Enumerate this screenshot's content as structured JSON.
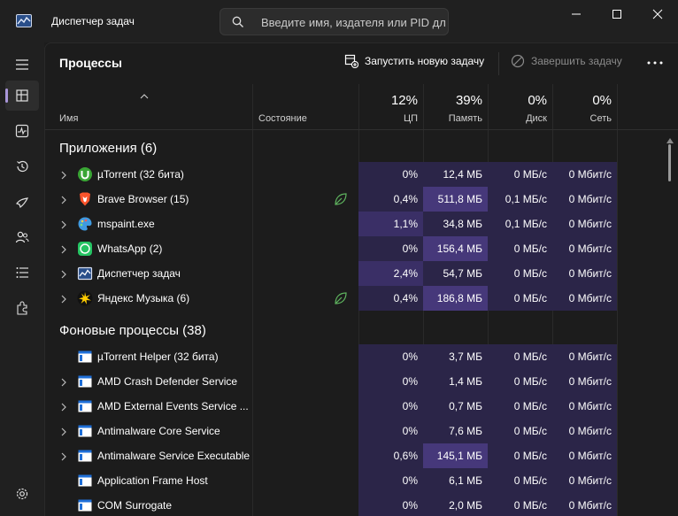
{
  "window": {
    "title": "Диспетчер задач",
    "search_placeholder": "Введите имя, издателя или PID для поиска"
  },
  "nav": {
    "items": [
      {
        "name": "processes",
        "icon": "processes-icon",
        "active": true
      },
      {
        "name": "performance",
        "icon": "performance-icon"
      },
      {
        "name": "app-history",
        "icon": "history-icon"
      },
      {
        "name": "startup",
        "icon": "startup-icon"
      },
      {
        "name": "users",
        "icon": "users-icon"
      },
      {
        "name": "details",
        "icon": "details-icon"
      },
      {
        "name": "services",
        "icon": "services-icon"
      }
    ],
    "settings_icon": "gear-icon"
  },
  "toolbar": {
    "page_title": "Процессы",
    "run_task": "Запустить новую задачу",
    "end_task": "Завершить задачу"
  },
  "table": {
    "headers": {
      "name": "Имя",
      "status": "Состояние",
      "cpu_pct": "12%",
      "cpu": "ЦП",
      "mem_pct": "39%",
      "mem": "Память",
      "disk_pct": "0%",
      "disk": "Диск",
      "net_pct": "0%",
      "net": "Сеть"
    },
    "apps_title": "Приложения (6)",
    "apps": [
      {
        "name": "µTorrent (32 бита)",
        "icon": "utorrent-icon",
        "cpu": "0%",
        "mem": "12,4 МБ",
        "disk": "0 МБ/с",
        "net": "0 Мбит/с",
        "expandable": true,
        "eco": false
      },
      {
        "name": "Brave Browser (15)",
        "icon": "brave-icon",
        "cpu": "0,4%",
        "mem": "511,8 МБ",
        "disk": "0,1 МБ/с",
        "net": "0 Мбит/с",
        "expandable": true,
        "eco": true
      },
      {
        "name": "mspaint.exe",
        "icon": "paint-icon",
        "cpu": "1,1%",
        "mem": "34,8 МБ",
        "disk": "0,1 МБ/с",
        "net": "0 Мбит/с",
        "expandable": true,
        "eco": false
      },
      {
        "name": "WhatsApp (2)",
        "icon": "whatsapp-icon",
        "cpu": "0%",
        "mem": "156,4 МБ",
        "disk": "0 МБ/с",
        "net": "0 Мбит/с",
        "expandable": true,
        "eco": false
      },
      {
        "name": "Диспетчер задач",
        "icon": "task-manager-icon",
        "cpu": "2,4%",
        "mem": "54,7 МБ",
        "disk": "0 МБ/с",
        "net": "0 Мбит/с",
        "expandable": true,
        "eco": false
      },
      {
        "name": "Яндекс Музыка (6)",
        "icon": "yandex-music-icon",
        "cpu": "0,4%",
        "mem": "186,8 МБ",
        "disk": "0 МБ/с",
        "net": "0 Мбит/с",
        "expandable": true,
        "eco": true
      }
    ],
    "bg_title": "Фоновые процессы (38)",
    "background": [
      {
        "name": "µTorrent Helper (32 бита)",
        "icon": "service-window-icon",
        "cpu": "0%",
        "mem": "3,7 МБ",
        "disk": "0 МБ/с",
        "net": "0 Мбит/с",
        "expandable": false
      },
      {
        "name": "AMD Crash Defender Service",
        "icon": "service-window-icon",
        "cpu": "0%",
        "mem": "1,4 МБ",
        "disk": "0 МБ/с",
        "net": "0 Мбит/с",
        "expandable": true
      },
      {
        "name": "AMD External Events Service ...",
        "icon": "service-window-icon",
        "cpu": "0%",
        "mem": "0,7 МБ",
        "disk": "0 МБ/с",
        "net": "0 Мбит/с",
        "expandable": true
      },
      {
        "name": "Antimalware Core Service",
        "icon": "service-window-icon",
        "cpu": "0%",
        "mem": "7,6 МБ",
        "disk": "0 МБ/с",
        "net": "0 Мбит/с",
        "expandable": true
      },
      {
        "name": "Antimalware Service Executable",
        "icon": "service-window-icon",
        "cpu": "0,6%",
        "mem": "145,1 МБ",
        "disk": "0 МБ/с",
        "net": "0 Мбит/с",
        "expandable": true
      },
      {
        "name": "Application Frame Host",
        "icon": "service-window-icon",
        "cpu": "0%",
        "mem": "6,1 МБ",
        "disk": "0 МБ/с",
        "net": "0 Мбит/с",
        "expandable": false
      },
      {
        "name": "COM Surrogate",
        "icon": "service-window-icon",
        "cpu": "0%",
        "mem": "2,0 МБ",
        "disk": "0 МБ/с",
        "net": "0 Мбит/с",
        "expandable": false
      }
    ]
  },
  "colors": {
    "heat_low": "#2b2548",
    "heat_mid": "#3a2f66",
    "heat_high": "#46387a",
    "accent": "#a996d9"
  }
}
